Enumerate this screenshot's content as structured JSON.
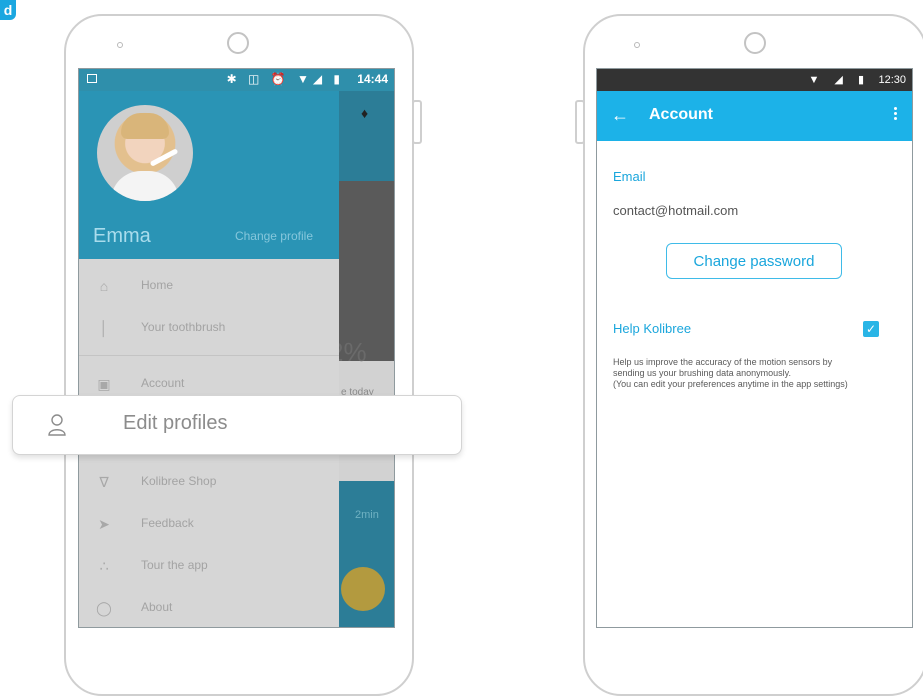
{
  "badge": "d",
  "left_phone": {
    "status_bar": {
      "time": "14:44",
      "icons": "✱ ◫ ⏰ ▼◢ ▮"
    },
    "drawer": {
      "profile_name": "Emma",
      "change_profile": "Change profile",
      "items": [
        {
          "label": "Home",
          "icon": "home-icon"
        },
        {
          "label": "Your toothbrush",
          "icon": "toothbrush-icon"
        },
        {
          "label": "Account",
          "icon": "lock-icon"
        },
        {
          "label": "Kolibree Shop",
          "icon": "cart-icon"
        },
        {
          "label": "Feedback",
          "icon": "send-icon"
        },
        {
          "label": "Tour the app",
          "icon": "tour-icon"
        },
        {
          "label": "About",
          "icon": "chat-icon"
        }
      ]
    },
    "background_app": {
      "percent": "2%",
      "caption": "e today",
      "duration": "2min"
    }
  },
  "edit_profiles": {
    "label": "Edit profiles",
    "icon": "person-icon"
  },
  "right_phone": {
    "status_bar": {
      "time": "12:30",
      "icons": "▼ ◢ ▮"
    },
    "app_bar": {
      "title": "Account"
    },
    "email": {
      "label": "Email",
      "value": "contact@hotmail.com"
    },
    "change_password": "Change password",
    "help": {
      "label": "Help Kolibree",
      "checked": true,
      "description_lines": [
        "Help us improve the accuracy of the motion sensors by",
        "sending us your brushing data anonymously.",
        "(You can edit your preferences anytime in the app settings)"
      ]
    }
  },
  "colors": {
    "accent": "#1cb2e8",
    "drawer_header": "#2a94b5",
    "overlay": "#d6d6d6"
  }
}
